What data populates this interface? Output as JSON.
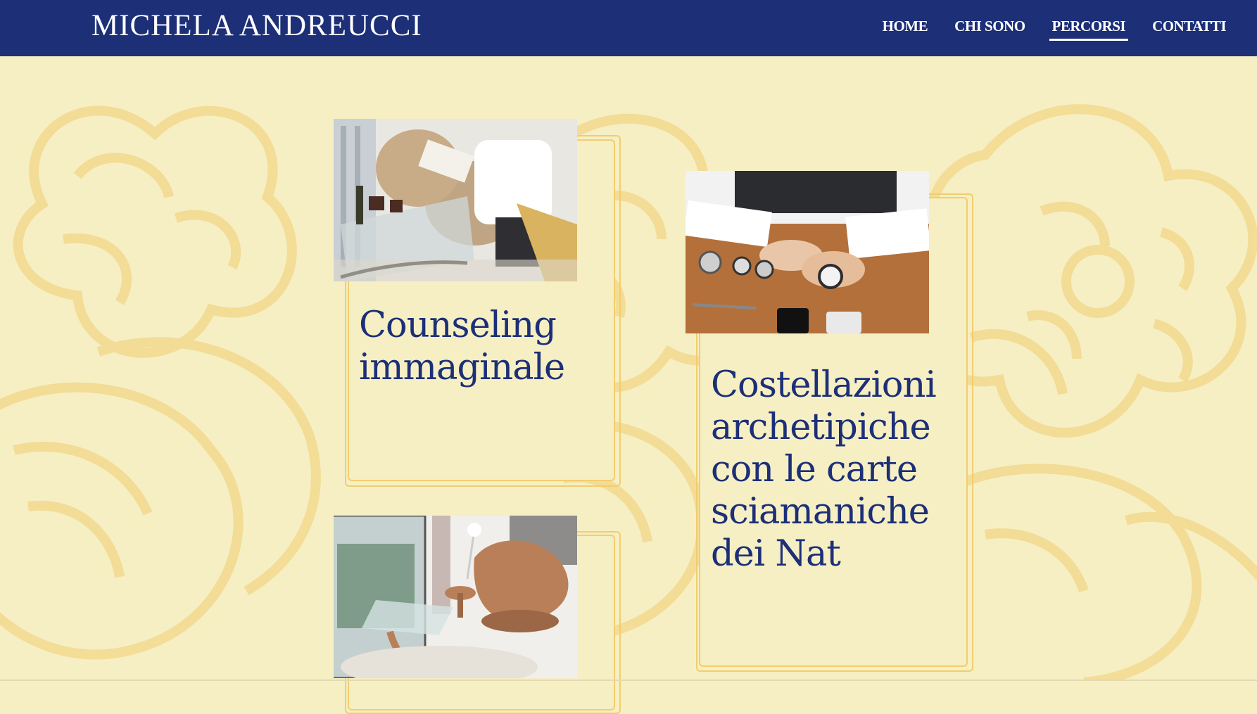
{
  "header": {
    "brand": "MICHELA ANDREUCCI",
    "nav": [
      {
        "label": "HOME",
        "active": false
      },
      {
        "label": "CHI SONO",
        "active": false
      },
      {
        "label": "PERCORSI",
        "active": true
      },
      {
        "label": "CONTATTI",
        "active": false
      }
    ]
  },
  "cards": [
    {
      "title": "Counseling immaginale",
      "photo": "people-reading-lounge-photo"
    },
    {
      "title": "Costellazioni archetipiche con le carte sciamaniche dei Nat",
      "photo": "watches-on-desk-photo"
    },
    {
      "title": "",
      "photo": "egg-chair-living-room-photo"
    }
  ],
  "colors": {
    "header_bg": "#1c2f77",
    "page_bg": "#f6efc4",
    "accent_gold": "#f2cd6e",
    "title_blue": "#1c2f77"
  }
}
